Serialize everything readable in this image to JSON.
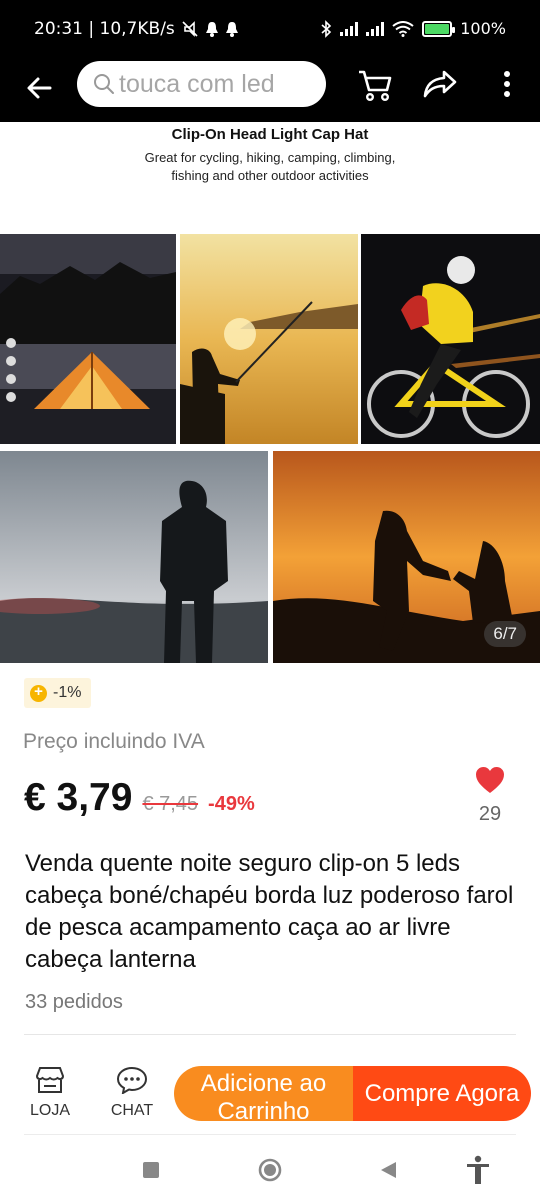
{
  "status_bar": {
    "time_speed": "20:31 | 10,7KB/s",
    "battery": "100%",
    "battery_level": 1.0,
    "icons": [
      "mute-icon",
      "notification-bell-icon",
      "bluetooth-icon",
      "signal-icon",
      "wifi-icon",
      "battery-icon"
    ]
  },
  "header": {
    "search_placeholder": "touca com led",
    "icons": [
      "back-arrow-icon",
      "search-icon",
      "cart-icon",
      "share-icon",
      "more-vertical-icon"
    ]
  },
  "gallery": {
    "banner_title": "Clip-On Head Light Cap Hat",
    "banner_subtitle_line1": "Great for cycling, hiking, camping, climbing,",
    "banner_subtitle_line2": "fishing and other outdoor activities",
    "counter": "6/7"
  },
  "product": {
    "coin_badge": "-1%",
    "vat_label": "Preço incluindo IVA",
    "price": "€ 3,79",
    "old_price": "€ 7,45",
    "discount": "-49%",
    "wishlist_count": "29",
    "title": "Venda quente noite seguro clip-on 5 leds cabeça boné/chapéu borda luz poderoso farol de pesca acampamento caça ao ar livre cabeça lanterna",
    "orders": "33 pedidos"
  },
  "bottom_bar": {
    "store_label": "LOJA",
    "chat_label": "CHAT",
    "add_to_cart": "Adicione ao Carrinho",
    "buy_now": "Compre Agora"
  },
  "colors": {
    "price_discount": "#e9383d",
    "cart_button": "#f98c1f",
    "buy_button": "#ff4a14",
    "heart": "#e9383d",
    "coin": "#f7b500"
  }
}
